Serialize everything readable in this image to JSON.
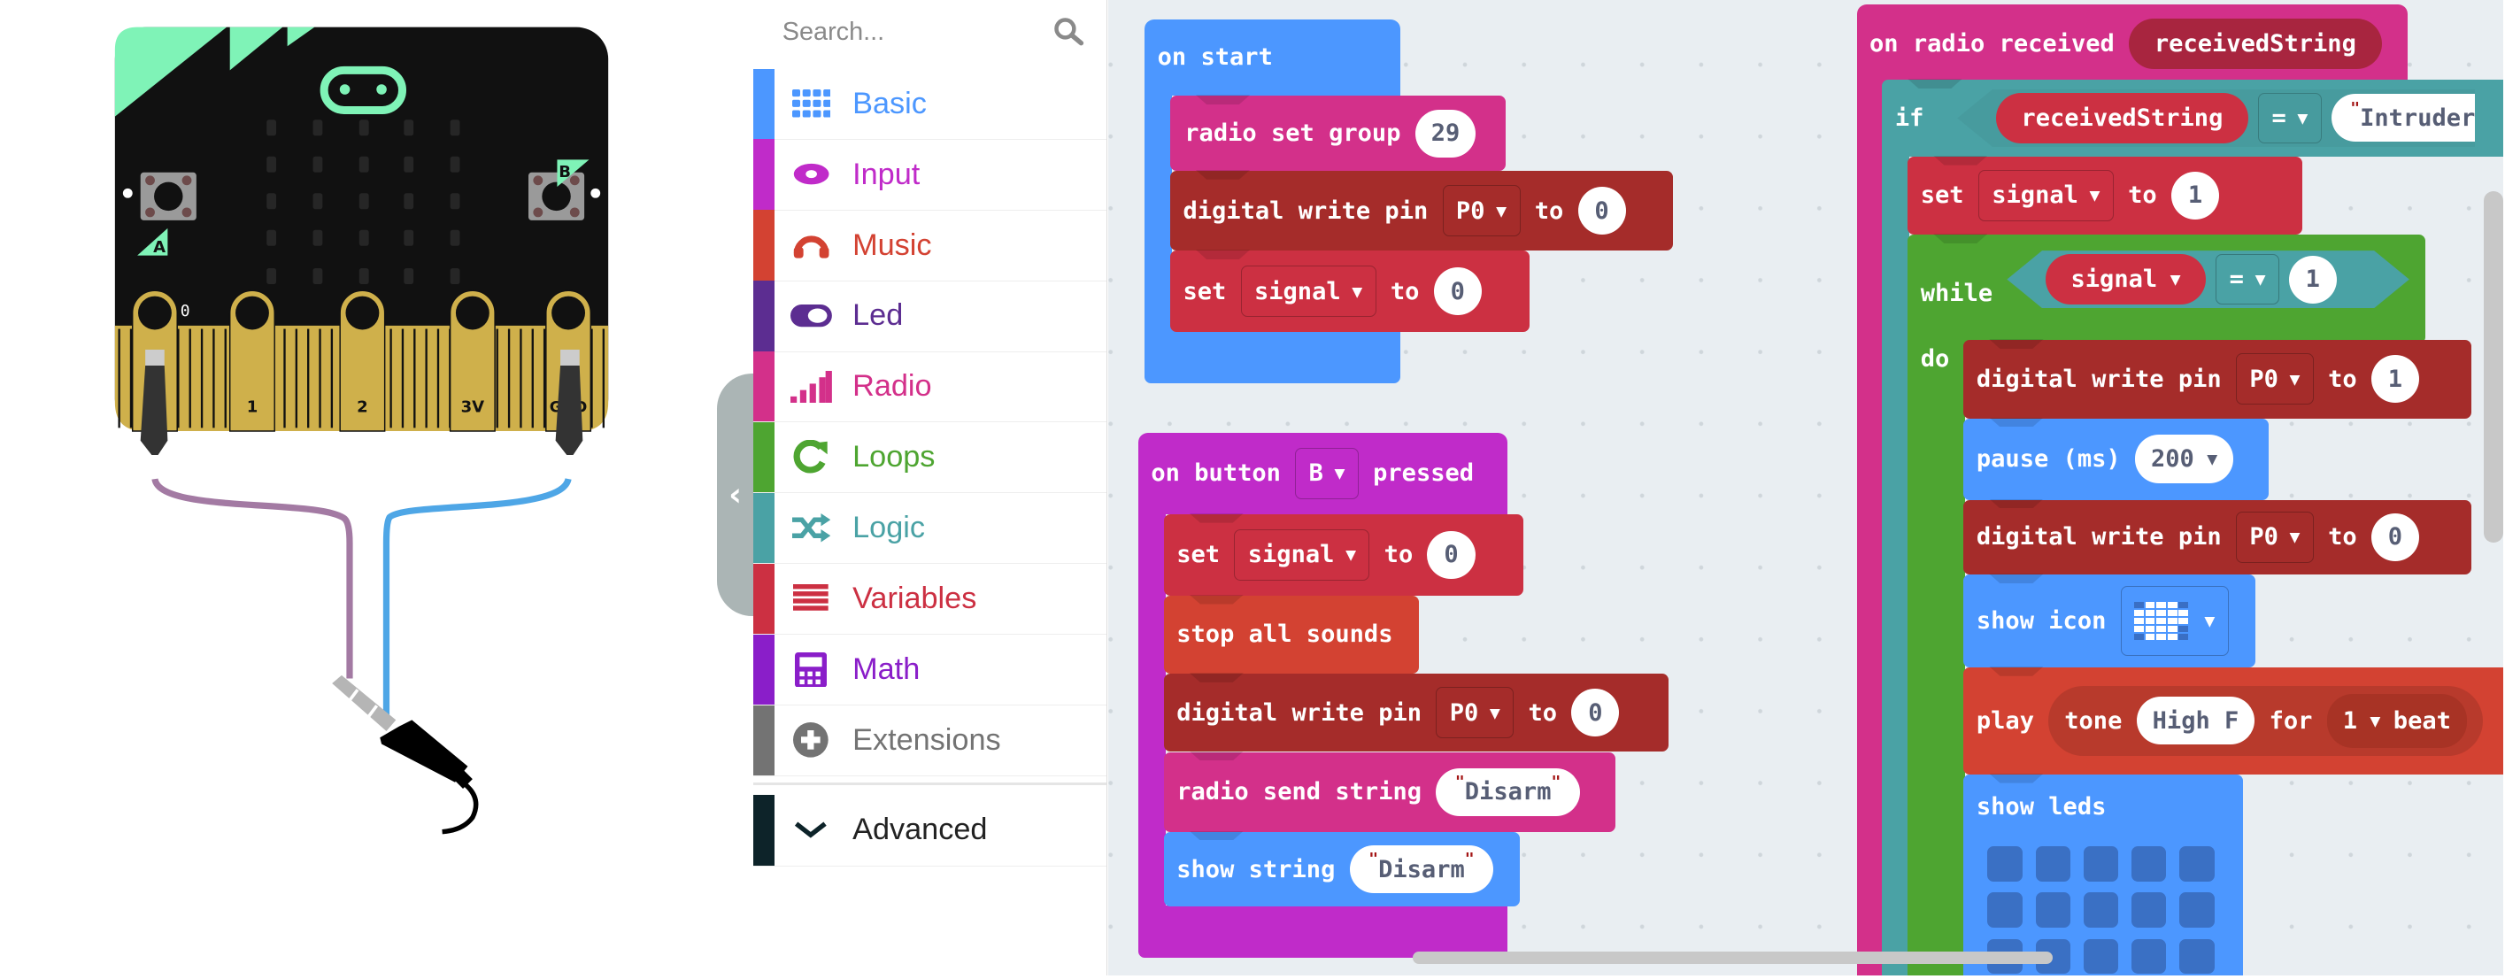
{
  "simulator": {
    "pins": [
      "0",
      "1",
      "2",
      "3V",
      "GND"
    ],
    "button_a": "A",
    "button_b": "B",
    "pin_readout": "0",
    "colors": {
      "board": "#111111",
      "accent": "#7ff3b7",
      "gold": "#cfb04b",
      "wire_p0": "#a37aa3",
      "wire_gnd": "#4ea6e6"
    }
  },
  "toolbox": {
    "search_placeholder": "Search...",
    "categories": [
      {
        "label": "Basic",
        "color": "#4c97ff",
        "icon": "grid-icon"
      },
      {
        "label": "Input",
        "color": "#c02bc9",
        "icon": "target-icon"
      },
      {
        "label": "Music",
        "color": "#d34232",
        "icon": "headphones-icon"
      },
      {
        "label": "Led",
        "color": "#5c2d91",
        "icon": "toggle-icon"
      },
      {
        "label": "Radio",
        "color": "#d3308a",
        "icon": "signal-bars-icon"
      },
      {
        "label": "Loops",
        "color": "#4ea531",
        "icon": "refresh-icon"
      },
      {
        "label": "Logic",
        "color": "#4aa2a5",
        "icon": "shuffle-icon"
      },
      {
        "label": "Variables",
        "color": "#cc3042",
        "icon": "lines-icon"
      },
      {
        "label": "Math",
        "color": "#8a1ec9",
        "icon": "calculator-icon"
      },
      {
        "label": "Extensions",
        "color": "#737373",
        "icon": "plus-circle-icon"
      }
    ],
    "advanced": {
      "label": "Advanced",
      "color": "#0d2329",
      "icon": "chevron-down-icon"
    }
  },
  "workspace": {
    "on_start": {
      "title": "on start",
      "radio_set_group": {
        "label": "radio set group",
        "value": "29"
      },
      "digital_write": {
        "label": "digital write pin",
        "pin": "P0",
        "to": "to",
        "value": "0"
      },
      "set_var": {
        "label": "set",
        "var": "signal",
        "to": "to",
        "value": "0"
      }
    },
    "on_button": {
      "on": "on button",
      "button": "B",
      "pressed": "pressed",
      "set_var": {
        "label": "set",
        "var": "signal",
        "to": "to",
        "value": "0"
      },
      "stop_sounds": "stop all sounds",
      "digital_write": {
        "label": "digital write pin",
        "pin": "P0",
        "to": "to",
        "value": "0"
      },
      "radio_send": {
        "label": "radio send string",
        "value": "Disarm"
      },
      "show_string": {
        "label": "show string",
        "value": "Disarm"
      }
    },
    "on_radio": {
      "title": "on radio received",
      "param": "receivedString",
      "if": {
        "label": "if",
        "left": "receivedString",
        "op": "=",
        "right": "Intruder"
      },
      "set_var": {
        "label": "set",
        "var": "signal",
        "to": "to",
        "value": "1"
      },
      "while": {
        "label": "while",
        "do": "do",
        "left": "signal",
        "op": "=",
        "right": "1"
      },
      "dw1": {
        "label": "digital write pin",
        "pin": "P0",
        "to": "to",
        "value": "1"
      },
      "pause": {
        "label": "pause (ms)",
        "value": "200"
      },
      "dw2": {
        "label": "digital write pin",
        "pin": "P0",
        "to": "to",
        "value": "0"
      },
      "show_icon": {
        "label": "show icon",
        "pattern": [
          [
            0,
            1,
            1,
            1,
            0
          ],
          [
            1,
            1,
            1,
            1,
            1
          ],
          [
            1,
            1,
            1,
            1,
            1
          ],
          [
            1,
            1,
            1,
            1,
            0
          ],
          [
            0,
            1,
            1,
            1,
            0
          ]
        ]
      },
      "play": {
        "label": "play",
        "tone": "tone",
        "note": "High F",
        "for": "for",
        "beats": "1",
        "beat": "beat"
      },
      "show_leds": {
        "label": "show leds"
      }
    }
  },
  "quote": "\""
}
